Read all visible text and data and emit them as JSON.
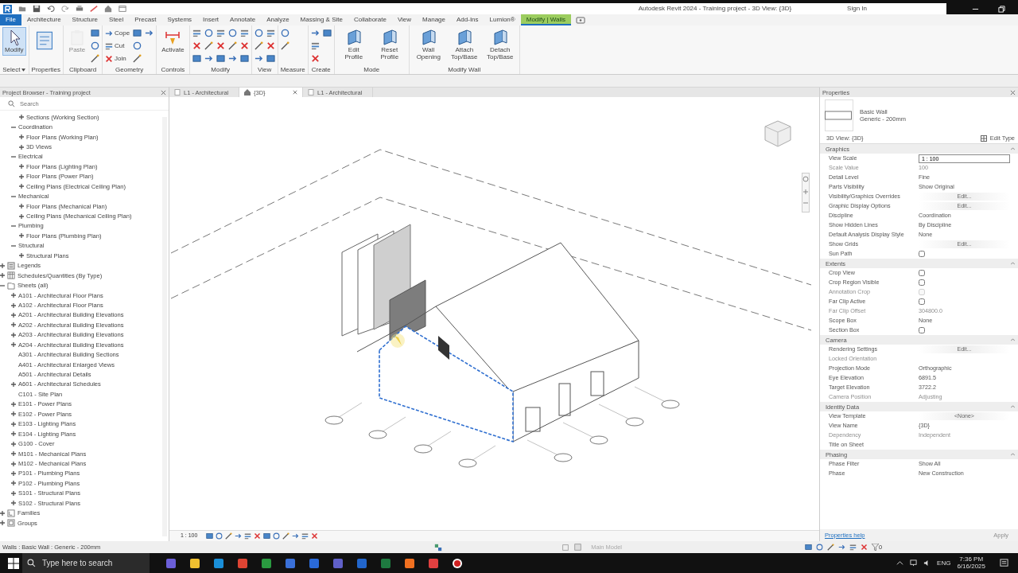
{
  "window": {
    "title": "Autodesk Revit 2024 - Training project - 3D View: {3D}",
    "sign_in": "Sign In"
  },
  "ribbon_tabs": [
    {
      "label": "File",
      "kind": "file",
      "selected": false
    },
    {
      "label": "Architecture",
      "kind": "tab",
      "selected": false
    },
    {
      "label": "Structure",
      "kind": "tab",
      "selected": false
    },
    {
      "label": "Steel",
      "kind": "tab",
      "selected": false
    },
    {
      "label": "Precast",
      "kind": "tab",
      "selected": false
    },
    {
      "label": "Systems",
      "kind": "tab",
      "selected": false
    },
    {
      "label": "Insert",
      "kind": "tab",
      "selected": false
    },
    {
      "label": "Annotate",
      "kind": "tab",
      "selected": false
    },
    {
      "label": "Analyze",
      "kind": "tab",
      "selected": false
    },
    {
      "label": "Massing & Site",
      "kind": "tab",
      "selected": false
    },
    {
      "label": "Collaborate",
      "kind": "tab",
      "selected": false
    },
    {
      "label": "View",
      "kind": "tab",
      "selected": false
    },
    {
      "label": "Manage",
      "kind": "tab",
      "selected": false
    },
    {
      "label": "Add-Ins",
      "kind": "tab",
      "selected": false
    },
    {
      "label": "Lumion®",
      "kind": "tab",
      "selected": false
    },
    {
      "label": "Modify | Walls",
      "kind": "context",
      "selected": true
    }
  ],
  "ribbon_panels": [
    {
      "label": "Select",
      "dropdown": true,
      "tools": [
        {
          "kind": "large",
          "label": "Modify",
          "selected": true,
          "disabled": false
        }
      ]
    },
    {
      "label": "Properties",
      "tools": [
        {
          "kind": "large",
          "selected": false,
          "disabled": false
        }
      ]
    },
    {
      "label": "Clipboard",
      "tools": [
        {
          "kind": "large",
          "label": "Paste",
          "selected": false,
          "disabled": true
        },
        {
          "kind": "small"
        },
        {
          "kind": "small"
        },
        {
          "kind": "small"
        }
      ]
    },
    {
      "label": "Geometry",
      "tools": [
        {
          "kind": "small",
          "label": "Cope"
        },
        {
          "kind": "small",
          "label": "Cut"
        },
        {
          "kind": "small",
          "label": "Join"
        },
        {
          "kind": "small"
        },
        {
          "kind": "small"
        },
        {
          "kind": "small"
        },
        {
          "kind": "small"
        }
      ]
    },
    {
      "label": "Controls",
      "tools": [
        {
          "kind": "large",
          "label": "Activate",
          "selected": false,
          "disabled": false
        }
      ]
    },
    {
      "label": "Modify",
      "tools": [
        {
          "kind": "small"
        },
        {
          "kind": "small"
        },
        {
          "kind": "small"
        },
        {
          "kind": "small"
        },
        {
          "kind": "small"
        },
        {
          "kind": "small"
        },
        {
          "kind": "small"
        },
        {
          "kind": "small"
        },
        {
          "kind": "small"
        },
        {
          "kind": "small"
        },
        {
          "kind": "small"
        },
        {
          "kind": "small"
        },
        {
          "kind": "small"
        },
        {
          "kind": "small"
        },
        {
          "kind": "small"
        }
      ]
    },
    {
      "label": "View",
      "tools": [
        {
          "kind": "small"
        },
        {
          "kind": "small"
        },
        {
          "kind": "small"
        },
        {
          "kind": "small"
        },
        {
          "kind": "small"
        },
        {
          "kind": "small"
        }
      ]
    },
    {
      "label": "Measure",
      "tools": [
        {
          "kind": "small"
        },
        {
          "kind": "small"
        }
      ]
    },
    {
      "label": "Create",
      "tools": [
        {
          "kind": "small"
        },
        {
          "kind": "small"
        },
        {
          "kind": "small"
        },
        {
          "kind": "small"
        }
      ]
    },
    {
      "label": "Mode",
      "tools": [
        {
          "kind": "large",
          "label": "Edit Profile",
          "selected": false,
          "disabled": false
        },
        {
          "kind": "large",
          "label": "Reset Profile",
          "selected": false,
          "disabled": false
        }
      ]
    },
    {
      "label": "Modify Wall",
      "tools": [
        {
          "kind": "large",
          "label": "Wall Opening",
          "selected": false,
          "disabled": false
        },
        {
          "kind": "large",
          "label": "Attach Top/Base",
          "selected": false,
          "disabled": false
        },
        {
          "kind": "large",
          "label": "Detach Top/Base",
          "selected": false,
          "disabled": false
        }
      ]
    }
  ],
  "project_browser": {
    "title": "Project Browser - Training project",
    "search": {
      "placeholder": "Search"
    },
    "tree": [
      {
        "children": [
          {
            "children": [
              {
                "label": "Sections (Working Section)",
                "expanded": false
              }
            ]
          },
          {
            "label": "Coordination",
            "expanded": true,
            "children": [
              {
                "label": "Floor Plans (Working Plan)",
                "expanded": false
              },
              {
                "label": "3D Views",
                "expanded": false
              }
            ]
          },
          {
            "label": "Electrical",
            "expanded": true,
            "children": [
              {
                "label": "Floor Plans (Lighting Plan)",
                "expanded": false
              },
              {
                "label": "Floor Plans (Power Plan)",
                "expanded": false
              },
              {
                "label": "Ceiling Plans (Electrical Ceiling Plan)",
                "expanded": false
              }
            ]
          },
          {
            "label": "Mechanical",
            "expanded": true,
            "children": [
              {
                "label": "Floor Plans (Mechanical Plan)",
                "expanded": false
              },
              {
                "label": "Ceiling Plans (Mechanical Ceiling Plan)",
                "expanded": false
              }
            ]
          },
          {
            "label": "Plumbing",
            "expanded": true,
            "children": [
              {
                "label": "Floor Plans (Plumbing Plan)",
                "expanded": false
              }
            ]
          },
          {
            "label": "Structural",
            "expanded": true,
            "children": [
              {
                "label": "Structural Plans",
                "expanded": false
              }
            ]
          }
        ]
      },
      {
        "label": "Legends",
        "kind": "legend",
        "expanded": false
      },
      {
        "label": "Schedules/Quantities (By Type)",
        "kind": "schedule",
        "expanded": false
      },
      {
        "label": "Sheets (all)",
        "kind": "sheet",
        "expanded": true,
        "children": [
          {
            "label": "A101 - Architectural Floor Plans",
            "expanded": false
          },
          {
            "label": "A102 - Architectural Floor Plans",
            "expanded": false
          },
          {
            "label": "A201 - Architectural Building Elevations",
            "expanded": false
          },
          {
            "label": "A202 - Architectural Building Elevations",
            "expanded": false
          },
          {
            "label": "A203 - Architectural Building Elevations",
            "expanded": false
          },
          {
            "label": "A204 - Architectural Building Elevations",
            "expanded": false
          },
          {
            "label": "A301 - Architectural Building Sections"
          },
          {
            "label": "A401 - Architectural Enlarged Views"
          },
          {
            "label": "A501 - Architectural Details"
          },
          {
            "label": "A601 - Architectural Schedules",
            "expanded": false
          },
          {
            "label": "C101 - Site Plan"
          },
          {
            "label": "E101 - Power Plans",
            "expanded": false
          },
          {
            "label": "E102 - Power Plans",
            "expanded": false
          },
          {
            "label": "E103 - Lighting Plans",
            "expanded": false
          },
          {
            "label": "E104 - Lighting Plans",
            "expanded": false
          },
          {
            "label": "G100 - Cover",
            "expanded": false
          },
          {
            "label": "M101 - Mechanical Plans",
            "expanded": false
          },
          {
            "label": "M102 - Mechanical Plans",
            "expanded": false
          },
          {
            "label": "P101 - Plumbing Plans",
            "expanded": false
          },
          {
            "label": "P102 - Plumbing Plans",
            "expanded": false
          },
          {
            "label": "S101 - Structural Plans",
            "expanded": false
          },
          {
            "label": "S102 - Structural Plans",
            "expanded": false
          }
        ]
      },
      {
        "label": "Families",
        "kind": "family",
        "expanded": false
      },
      {
        "label": "Groups",
        "kind": "group",
        "expanded": false
      }
    ]
  },
  "view_tabs": [
    {
      "label": "L1 - Architectural",
      "selected": false,
      "closable": false
    },
    {
      "label": "{3D}",
      "selected": true,
      "closable": true
    },
    {
      "label": "L1 - Architectural",
      "selected": false,
      "closable": false
    }
  ],
  "view_control_bar": {
    "scale": "1 : 100"
  },
  "properties": {
    "title": "Properties",
    "type_family": "Basic Wall",
    "type_name": "Generic - 200mm",
    "selector": "3D View: {3D}",
    "edit_type": "Edit Type",
    "sections": [
      {
        "label": "Graphics",
        "rows": [
          {
            "name": "View Scale",
            "kind": "field",
            "value": "1 : 100",
            "disabled": false
          },
          {
            "name": "Scale Value",
            "kind": "text",
            "value": "100",
            "disabled": true
          },
          {
            "name": "Detail Level",
            "kind": "text",
            "value": "Fine",
            "disabled": false
          },
          {
            "name": "Parts Visibility",
            "kind": "text",
            "value": "Show Original",
            "disabled": false
          },
          {
            "name": "Visibility/Graphics Overrides",
            "kind": "button",
            "value": "Edit...",
            "disabled": false
          },
          {
            "name": "Graphic Display Options",
            "kind": "button",
            "value": "Edit...",
            "disabled": false
          },
          {
            "name": "Discipline",
            "kind": "text",
            "value": "Coordination",
            "disabled": false
          },
          {
            "name": "Show Hidden Lines",
            "kind": "text",
            "value": "By Discipline",
            "disabled": false
          },
          {
            "name": "Default Analysis Display Style",
            "kind": "text",
            "value": "None",
            "disabled": false
          },
          {
            "name": "Show Grids",
            "kind": "button",
            "value": "Edit...",
            "disabled": false
          },
          {
            "name": "Sun Path",
            "kind": "checkbox",
            "checked": false,
            "disabled": false
          }
        ]
      },
      {
        "label": "Extents",
        "rows": [
          {
            "name": "Crop View",
            "kind": "checkbox",
            "checked": false,
            "disabled": false
          },
          {
            "name": "Crop Region Visible",
            "kind": "checkbox",
            "checked": false,
            "disabled": false
          },
          {
            "name": "Annotation Crop",
            "kind": "checkbox",
            "checked": false,
            "disabled": true
          },
          {
            "name": "Far Clip Active",
            "kind": "checkbox",
            "checked": false,
            "disabled": false
          },
          {
            "name": "Far Clip Offset",
            "kind": "text",
            "value": "304800.0",
            "disabled": true
          },
          {
            "name": "Scope Box",
            "kind": "text",
            "value": "None",
            "disabled": false
          },
          {
            "name": "Section Box",
            "kind": "checkbox",
            "checked": false,
            "disabled": false
          }
        ]
      },
      {
        "label": "Camera",
        "rows": [
          {
            "name": "Rendering Settings",
            "kind": "button",
            "value": "Edit...",
            "disabled": false
          },
          {
            "name": "Locked Orientation",
            "kind": "empty",
            "disabled": true
          },
          {
            "name": "Projection Mode",
            "kind": "text",
            "value": "Orthographic",
            "disabled": false
          },
          {
            "name": "Eye Elevation",
            "kind": "text",
            "value": "6891.5",
            "disabled": false
          },
          {
            "name": "Target Elevation",
            "kind": "text",
            "value": "3722.2",
            "disabled": false
          },
          {
            "name": "Camera Position",
            "kind": "text",
            "value": "Adjusting",
            "disabled": true
          }
        ]
      },
      {
        "label": "Identity Data",
        "rows": [
          {
            "name": "View Template",
            "kind": "button",
            "value": "<None>",
            "disabled": false
          },
          {
            "name": "View Name",
            "kind": "text",
            "value": "{3D}",
            "disabled": false
          },
          {
            "name": "Dependency",
            "kind": "text",
            "value": "Independent",
            "disabled": true
          },
          {
            "name": "Title on Sheet",
            "kind": "empty",
            "disabled": false
          }
        ]
      },
      {
        "label": "Phasing",
        "rows": [
          {
            "name": "Phase Filter",
            "kind": "text",
            "value": "Show All",
            "disabled": false
          },
          {
            "name": "Phase",
            "kind": "text",
            "value": "New Construction",
            "disabled": false
          }
        ]
      }
    ],
    "help_link": "Properties help",
    "apply": {
      "label": "Apply",
      "disabled": true
    }
  },
  "status_bar": {
    "message": "Walls : Basic Wall : Generic - 200mm",
    "model": "Main Model",
    "filter_count": "0"
  },
  "taskbar": {
    "search_placeholder": "Type here to search",
    "language": "ENG",
    "time": "7:36 PM",
    "date": "6/16/2025"
  }
}
